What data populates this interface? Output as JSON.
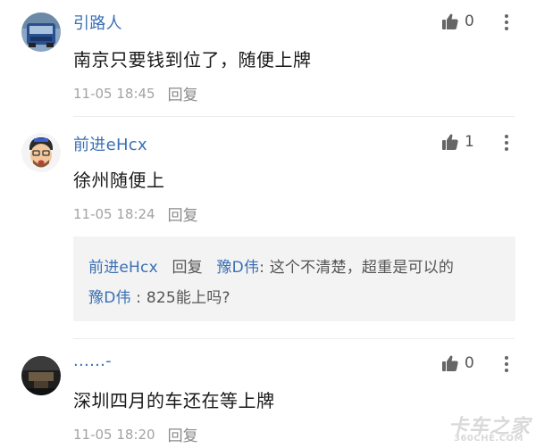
{
  "comments": [
    {
      "username": "引路人",
      "likes": "0",
      "content": "南京只要钱到位了，随便上牌",
      "time": "11-05 18:45",
      "reply_label": "回复",
      "avatar": "truck-avatar"
    },
    {
      "username": "前进eHcx",
      "likes": "1",
      "content": "徐州随便上",
      "time": "11-05 18:24",
      "reply_label": "回复",
      "avatar": "cartoon-avatar",
      "quote": {
        "line1_user": "前进eHcx",
        "line1_reply": "回复",
        "line1_target": "豫D伟",
        "line1_text": ": 这个不清楚，超重是可以的",
        "line2_user": "豫D伟",
        "line2_text": " : 825能上吗?"
      }
    },
    {
      "username": "......-",
      "likes": "0",
      "content": "深圳四月的车还在等上牌",
      "time": "11-05 18:20",
      "reply_label": "回复",
      "avatar": "dark-interior-avatar"
    }
  ],
  "watermark": {
    "main": "卡车之家",
    "sub": "360CHE.COM"
  },
  "icons": {
    "like": "thumbs-up-icon",
    "more": "more-vertical-icon"
  },
  "colors": {
    "username": "#3a6fb5",
    "meta": "#a3a3a3",
    "quote_bg": "#f3f3f3"
  }
}
